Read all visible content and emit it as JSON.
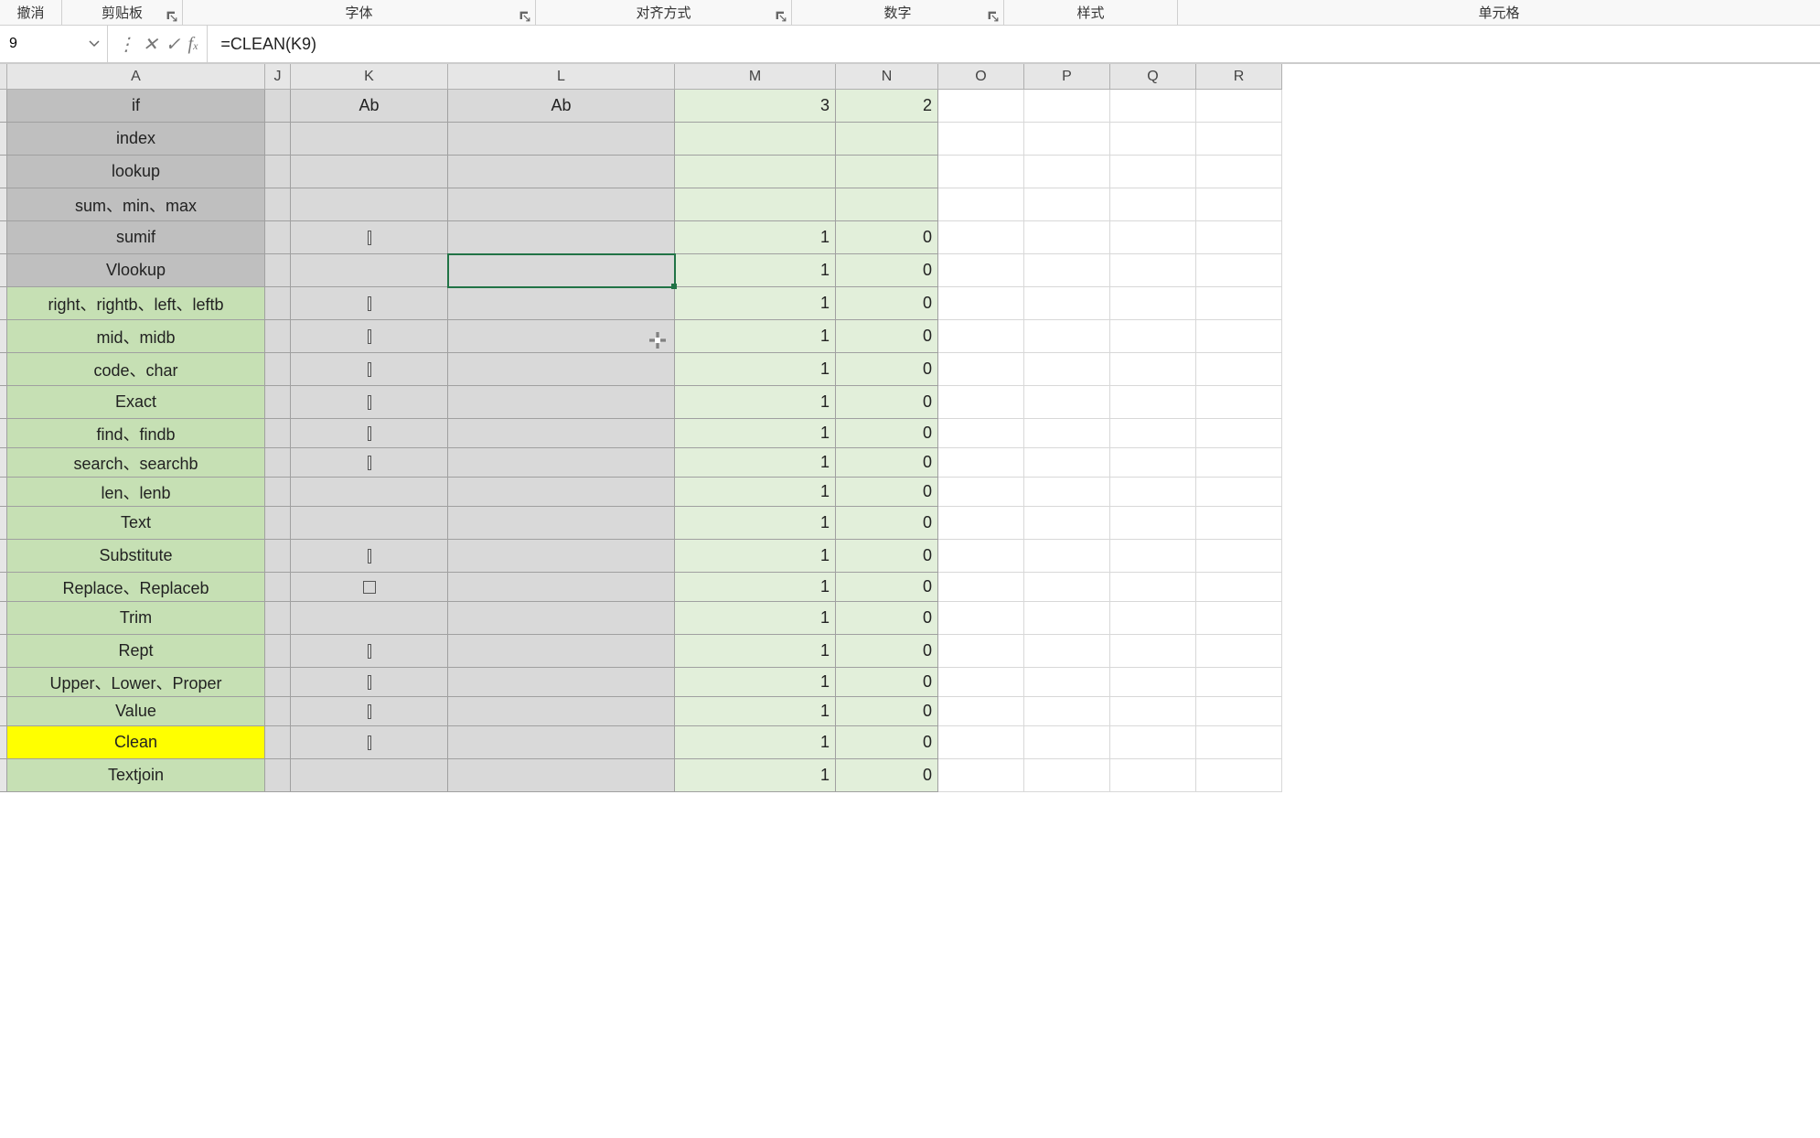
{
  "ribbon": {
    "undo": "撤消",
    "clipboard": "剪贴板",
    "font": "字体",
    "align": "对齐方式",
    "number": "数字",
    "style": "样式",
    "cell": "单元格"
  },
  "namebox": {
    "value": "9"
  },
  "formula": {
    "value": "=CLEAN(K9)"
  },
  "columns": [
    "A",
    "J",
    "K",
    "L",
    "M",
    "N",
    "O",
    "P",
    "Q",
    "R"
  ],
  "colA": [
    {
      "text": "if",
      "bg": "darkgray"
    },
    {
      "text": "index",
      "bg": "darkgray"
    },
    {
      "text": "lookup",
      "bg": "darkgray"
    },
    {
      "text": "sum、min、max",
      "bg": "darkgray"
    },
    {
      "text": "sumif",
      "bg": "darkgray"
    },
    {
      "text": "Vlookup",
      "bg": "darkgray"
    },
    {
      "text": "right、rightb、left、leftb",
      "bg": "cellgreen"
    },
    {
      "text": "mid、midb",
      "bg": "cellgreen"
    },
    {
      "text": "code、char",
      "bg": "cellgreen"
    },
    {
      "text": "Exact",
      "bg": "cellgreen"
    },
    {
      "text": "find、findb",
      "bg": "cellgreen",
      "short": true
    },
    {
      "text": "search、searchb",
      "bg": "cellgreen",
      "short": true
    },
    {
      "text": "len、lenb",
      "bg": "cellgreen",
      "short": true
    },
    {
      "text": "Text",
      "bg": "cellgreen"
    },
    {
      "text": "Substitute",
      "bg": "cellgreen"
    },
    {
      "text": "Replace、Replaceb",
      "bg": "cellgreen",
      "short": true
    },
    {
      "text": "Trim",
      "bg": "cellgreen"
    },
    {
      "text": "Rept",
      "bg": "cellgreen"
    },
    {
      "text": "Upper、Lower、Proper",
      "bg": "cellgreen",
      "short": true
    },
    {
      "text": "Value",
      "bg": "cellgreen",
      "short": true
    },
    {
      "text": "Clean",
      "bg": "yellow"
    },
    {
      "text": "Textjoin",
      "bg": "cellgreen"
    }
  ],
  "rows": [
    {
      "K": {
        "t": "Ab",
        "a": "center"
      },
      "L": {
        "t": "Ab",
        "a": "center"
      },
      "M": {
        "t": "3"
      },
      "N": {
        "t": "2"
      }
    },
    {},
    {},
    {},
    {
      "K": {
        "t": "",
        "glyph": "bar"
      },
      "M": {
        "t": "1"
      },
      "N": {
        "t": "0"
      }
    },
    {
      "M": {
        "t": "1"
      },
      "N": {
        "t": "0"
      },
      "selectL": true
    },
    {
      "K": {
        "t": "",
        "glyph": "bar"
      },
      "M": {
        "t": "1"
      },
      "N": {
        "t": "0"
      }
    },
    {
      "K": {
        "t": "",
        "glyph": "bar"
      },
      "M": {
        "t": "1"
      },
      "N": {
        "t": "0"
      }
    },
    {
      "K": {
        "t": "",
        "glyph": "bar"
      },
      "M": {
        "t": "1"
      },
      "N": {
        "t": "0"
      }
    },
    {
      "K": {
        "t": "",
        "glyph": "bar"
      },
      "M": {
        "t": "1"
      },
      "N": {
        "t": "0"
      }
    },
    {
      "K": {
        "t": "",
        "glyph": "bar"
      },
      "M": {
        "t": "1"
      },
      "N": {
        "t": "0"
      },
      "short": true
    },
    {
      "K": {
        "t": "",
        "glyph": "bar"
      },
      "M": {
        "t": "1"
      },
      "N": {
        "t": "0"
      },
      "short": true
    },
    {
      "M": {
        "t": "1"
      },
      "N": {
        "t": "0"
      },
      "short": true
    },
    {
      "M": {
        "t": "1"
      },
      "N": {
        "t": "0"
      }
    },
    {
      "K": {
        "t": "",
        "glyph": "bar"
      },
      "M": {
        "t": "1"
      },
      "N": {
        "t": "0"
      }
    },
    {
      "K": {
        "t": "",
        "glyph": "rect"
      },
      "M": {
        "t": "1"
      },
      "N": {
        "t": "0"
      },
      "short": true
    },
    {
      "M": {
        "t": "1"
      },
      "N": {
        "t": "0"
      }
    },
    {
      "K": {
        "t": "",
        "glyph": "bar"
      },
      "M": {
        "t": "1"
      },
      "N": {
        "t": "0"
      }
    },
    {
      "K": {
        "t": "",
        "glyph": "bar"
      },
      "M": {
        "t": "1"
      },
      "N": {
        "t": "0"
      },
      "short": true
    },
    {
      "K": {
        "t": "",
        "glyph": "bar"
      },
      "M": {
        "t": "1"
      },
      "N": {
        "t": "0"
      },
      "short": true
    },
    {
      "K": {
        "t": "",
        "glyph": "bar"
      },
      "M": {
        "t": "1"
      },
      "N": {
        "t": "0"
      }
    },
    {
      "M": {
        "t": "1"
      },
      "N": {
        "t": "0"
      }
    }
  ]
}
